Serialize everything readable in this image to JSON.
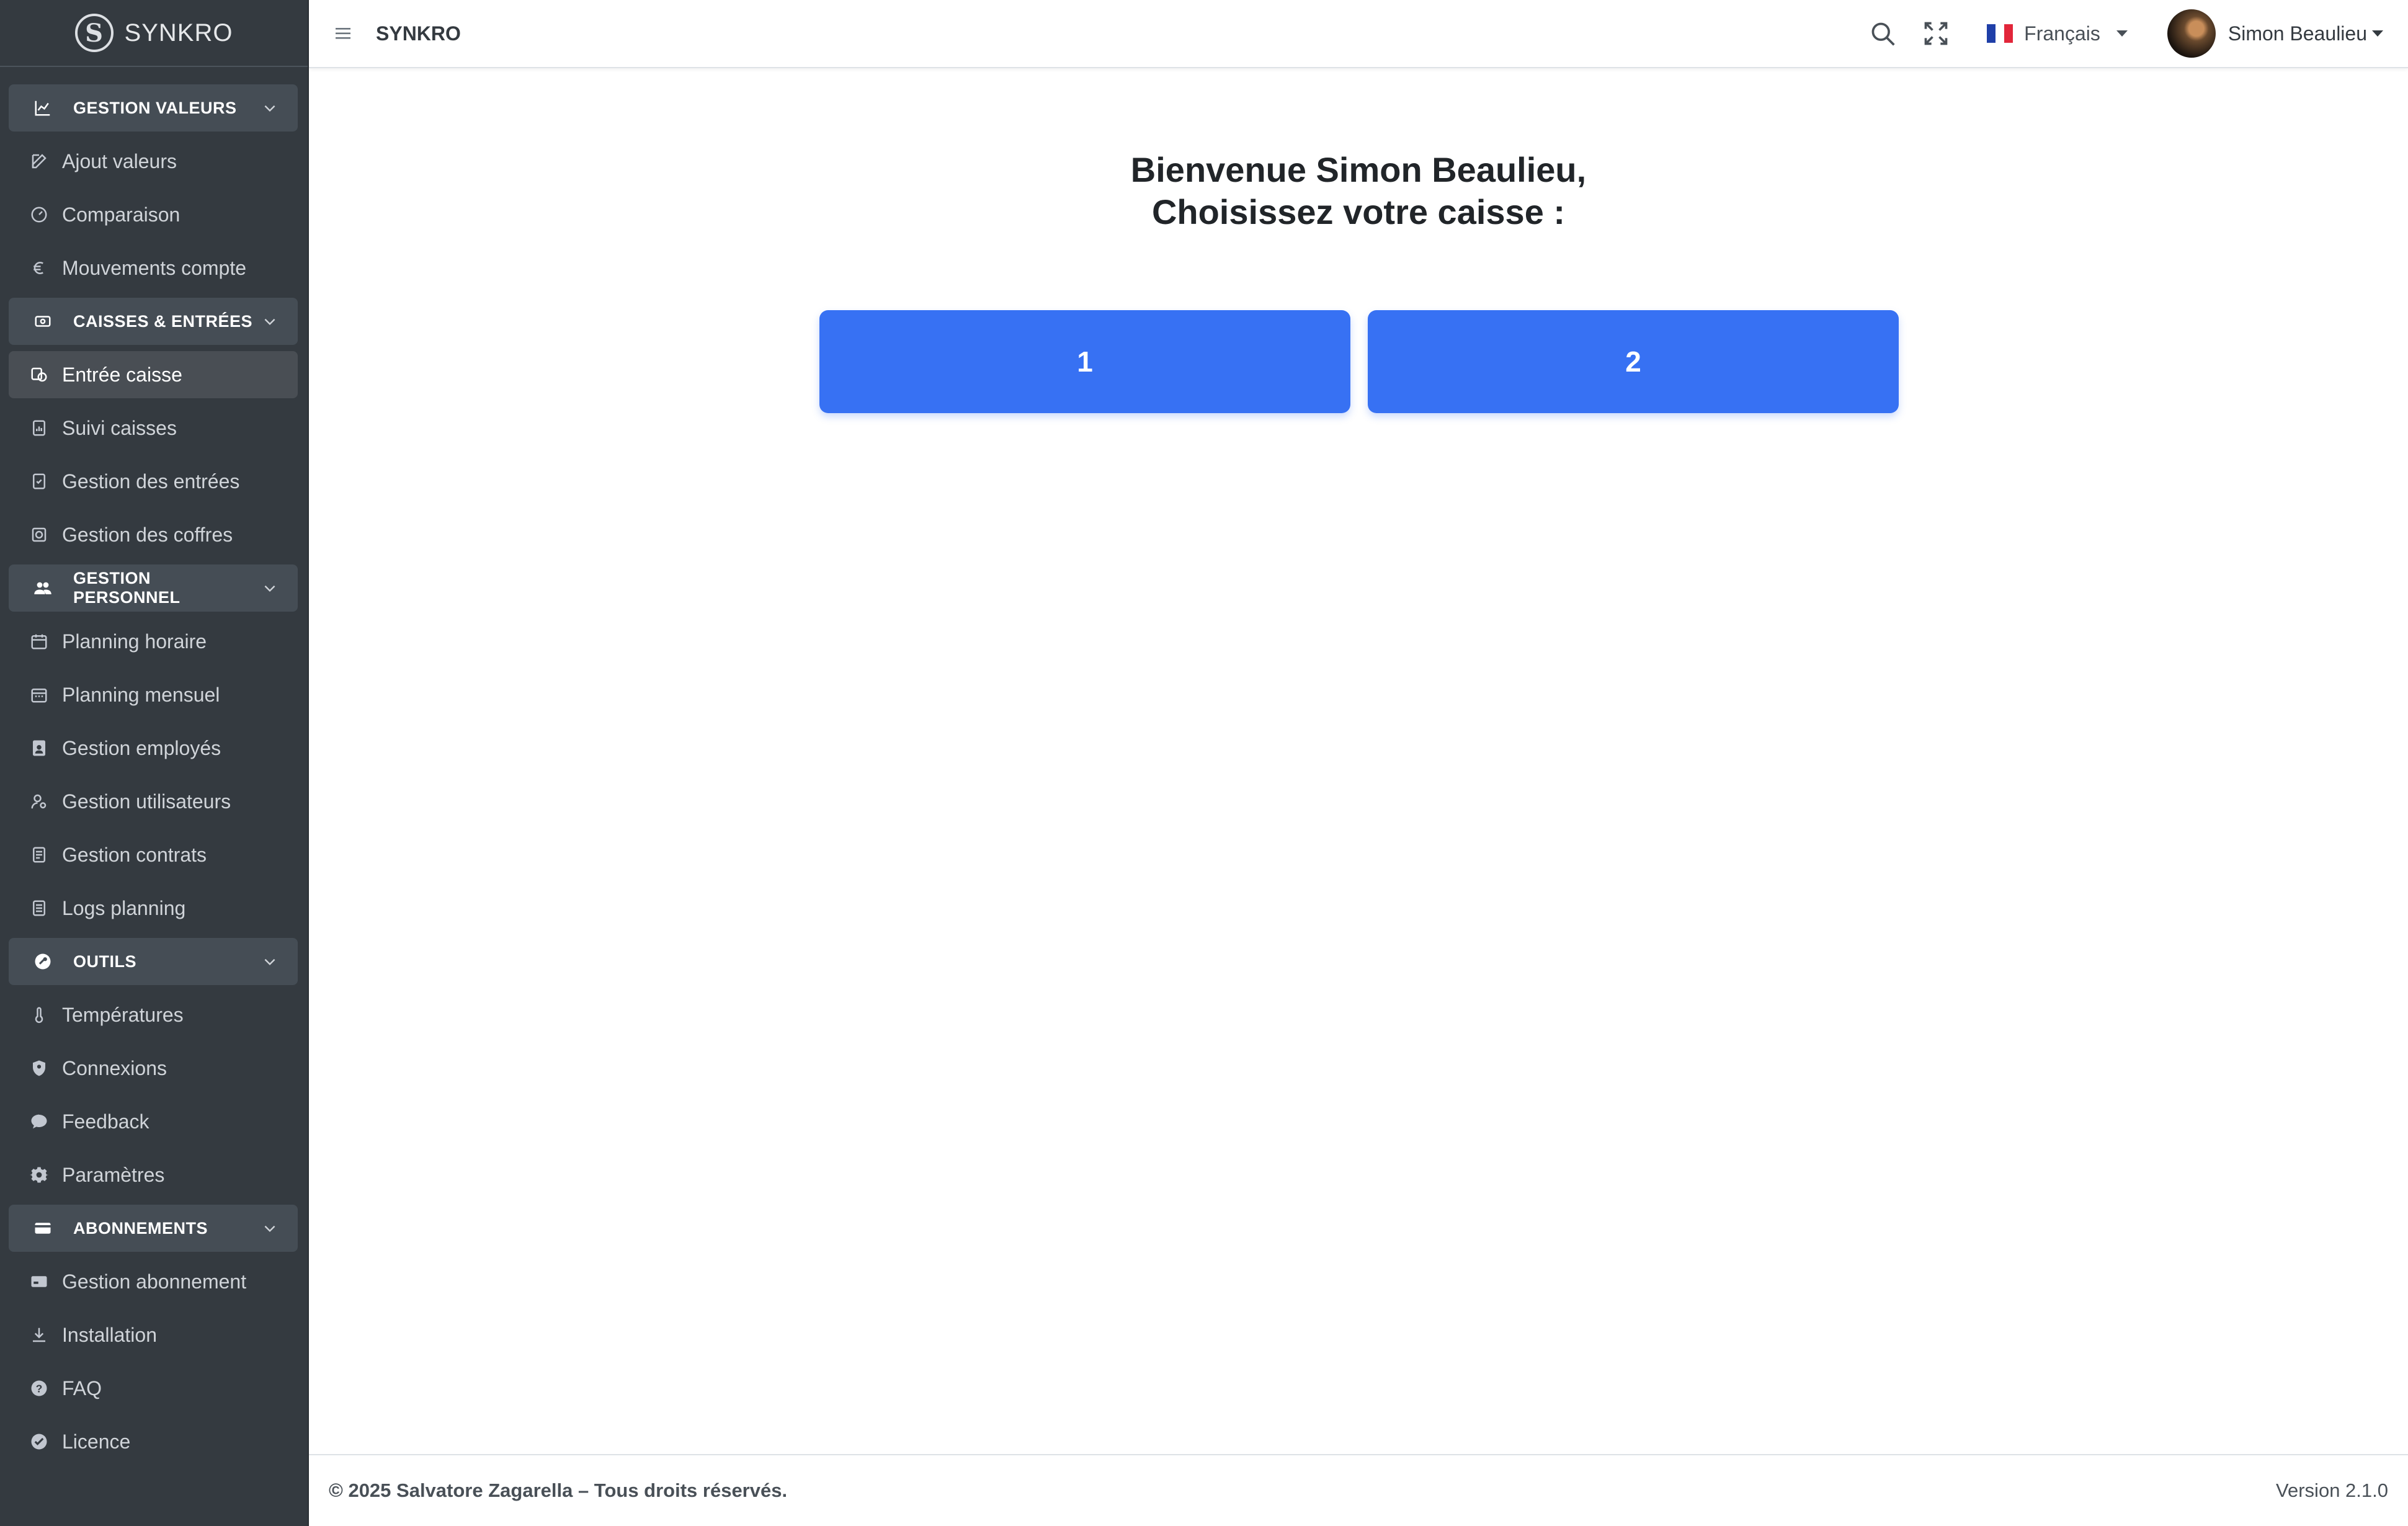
{
  "brand": {
    "logo_letter": "S",
    "name": "SYNKRO"
  },
  "sidebar": {
    "sections": [
      {
        "header": "GESTION VALEURS",
        "icon": "chart-line-icon",
        "items": [
          {
            "label": "Ajout valeurs",
            "icon": "edit-icon"
          },
          {
            "label": "Comparaison",
            "icon": "gauge-icon"
          },
          {
            "label": "Mouvements compte",
            "icon": "euro-icon"
          }
        ]
      },
      {
        "header": "CAISSES & ENTRÉES",
        "icon": "cash-register-icon",
        "items": [
          {
            "label": "Entrée caisse",
            "icon": "coins-icon",
            "active": true
          },
          {
            "label": "Suivi caisses",
            "icon": "clipboard-chart-icon"
          },
          {
            "label": "Gestion des entrées",
            "icon": "clipboard-check-icon"
          },
          {
            "label": "Gestion des coffres",
            "icon": "safe-icon"
          }
        ]
      },
      {
        "header": "GESTION PERSONNEL",
        "icon": "users-icon",
        "items": [
          {
            "label": "Planning horaire",
            "icon": "calendar-icon"
          },
          {
            "label": "Planning mensuel",
            "icon": "calendar-month-icon"
          },
          {
            "label": "Gestion employés",
            "icon": "id-badge-icon"
          },
          {
            "label": "Gestion utilisateurs",
            "icon": "user-cog-icon"
          },
          {
            "label": "Gestion contrats",
            "icon": "contract-icon"
          },
          {
            "label": "Logs planning",
            "icon": "log-icon"
          }
        ]
      },
      {
        "header": "OUTILS",
        "icon": "tools-icon",
        "items": [
          {
            "label": "Températures",
            "icon": "thermometer-icon"
          },
          {
            "label": "Connexions",
            "icon": "shield-icon"
          },
          {
            "label": "Feedback",
            "icon": "comment-icon"
          },
          {
            "label": "Paramètres",
            "icon": "gear-icon"
          }
        ]
      },
      {
        "header": "ABONNEMENTS",
        "icon": "credit-card-icon",
        "items": [
          {
            "label": "Gestion abonnement",
            "icon": "card-icon"
          },
          {
            "label": "Installation",
            "icon": "download-icon"
          },
          {
            "label": "FAQ",
            "icon": "question-icon"
          },
          {
            "label": "Licence",
            "icon": "check-badge-icon"
          }
        ]
      }
    ]
  },
  "topbar": {
    "app_name": "SYNKRO",
    "language": "Français",
    "user_name": "Simon Beaulieu"
  },
  "main": {
    "welcome_line1": "Bienvenue Simon Beaulieu,",
    "welcome_line2": "Choisissez votre caisse :",
    "caisses": [
      "1",
      "2"
    ],
    "button_color": "#3771f3"
  },
  "footer": {
    "copyright": "© 2025 Salvatore Zagarella – Tous droits réservés.",
    "version": "Version 2.1.0"
  }
}
